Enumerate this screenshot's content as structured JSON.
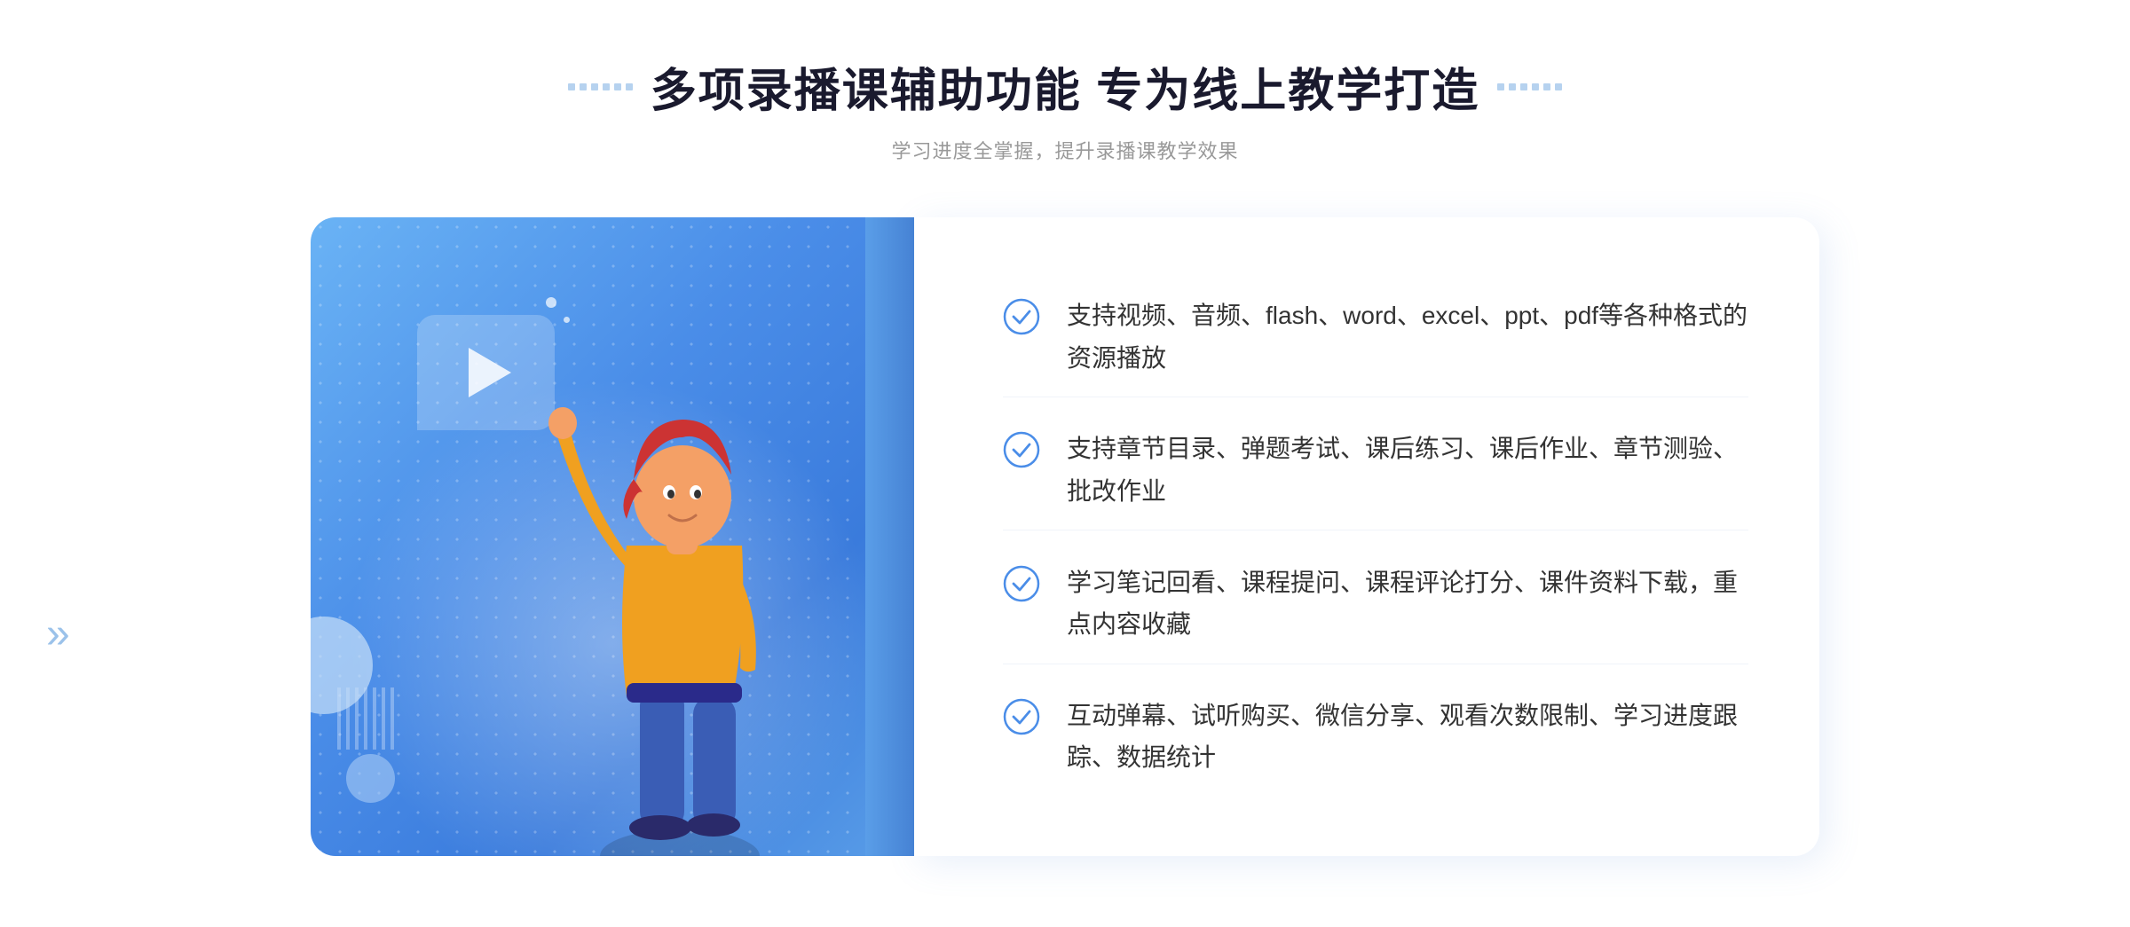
{
  "header": {
    "title": "多项录播课辅助功能 专为线上教学打造",
    "subtitle": "学习进度全掌握，提升录播课教学效果"
  },
  "features": [
    {
      "id": "feature-1",
      "text": "支持视频、音频、flash、word、excel、ppt、pdf等各种格式的资源播放"
    },
    {
      "id": "feature-2",
      "text": "支持章节目录、弹题考试、课后练习、课后作业、章节测验、批改作业"
    },
    {
      "id": "feature-3",
      "text": "学习笔记回看、课程提问、课程评论打分、课件资料下载，重点内容收藏"
    },
    {
      "id": "feature-4",
      "text": "互动弹幕、试听购买、微信分享、观看次数限制、学习进度跟踪、数据统计"
    }
  ],
  "decorations": {
    "left_chevron": "»",
    "outer_chevron": "»"
  }
}
